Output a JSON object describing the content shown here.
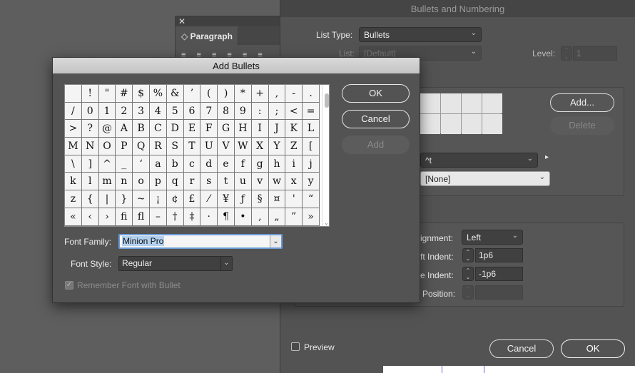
{
  "paragraph_panel": {
    "close_glyph": "✕",
    "tab_label": "Paragraph",
    "align_glyphs": "≡ ≡ ≡  ≡ ≡ ≡"
  },
  "bullets_numbering": {
    "title": "Bullets and Numbering",
    "list_type_label": "List Type:",
    "list_type_value": "Bullets",
    "list_label": "List:",
    "list_value": "[Default]",
    "level_label": "Level:",
    "level_value": "1",
    "add_button": "Add...",
    "delete_button": "Delete",
    "text_after_value": "^t",
    "char_style_value": "[None]",
    "alignment_label": "ignment:",
    "alignment_value": "Left",
    "left_indent_label": "ft Indent:",
    "left_indent_value": "1p6",
    "first_line_indent_label": "e Indent:",
    "first_line_indent_value": "-1p6",
    "tab_position_label": "Position:",
    "tab_position_value": "",
    "preview_label": "Preview",
    "cancel_button": "Cancel",
    "ok_button": "OK"
  },
  "add_bullets": {
    "title": "Add Bullets",
    "glyphs": [
      " ",
      "!",
      "\"",
      "#",
      "$",
      "%",
      "&",
      "’",
      "(",
      ")",
      "*",
      "+",
      ",",
      "-",
      ".",
      "/",
      "0",
      "1",
      "2",
      "3",
      "4",
      "5",
      "6",
      "7",
      "8",
      "9",
      ":",
      ";",
      "<",
      "=",
      ">",
      "?",
      "@",
      "A",
      "B",
      "C",
      "D",
      "E",
      "F",
      "G",
      "H",
      "I",
      "J",
      "K",
      "L",
      "M",
      "N",
      "O",
      "P",
      "Q",
      "R",
      "S",
      "T",
      "U",
      "V",
      "W",
      "X",
      "Y",
      "Z",
      "[",
      "\\",
      "]",
      "^",
      "_",
      "‘",
      "a",
      "b",
      "c",
      "d",
      "e",
      "f",
      "g",
      "h",
      "i",
      "j",
      "k",
      "l",
      "m",
      "n",
      "o",
      "p",
      "q",
      "r",
      "s",
      "t",
      "u",
      "v",
      "w",
      "x",
      "y",
      "z",
      "{",
      "|",
      "}",
      "~",
      "¡",
      "¢",
      "£",
      "⁄",
      "¥",
      "ƒ",
      "§",
      "¤",
      "'",
      "“",
      "«",
      "‹",
      "›",
      "fi",
      "fl",
      "–",
      "†",
      "‡",
      "·",
      "¶",
      "•",
      "‚",
      "„",
      "”",
      "»"
    ],
    "ok_button": "OK",
    "cancel_button": "Cancel",
    "add_button": "Add",
    "font_family_label": "Font Family:",
    "font_family_value": "Minion Pro",
    "font_style_label": "Font Style:",
    "font_style_value": "Regular",
    "remember_font_label": "Remember Font with Bullet",
    "remember_font_checked": true
  }
}
